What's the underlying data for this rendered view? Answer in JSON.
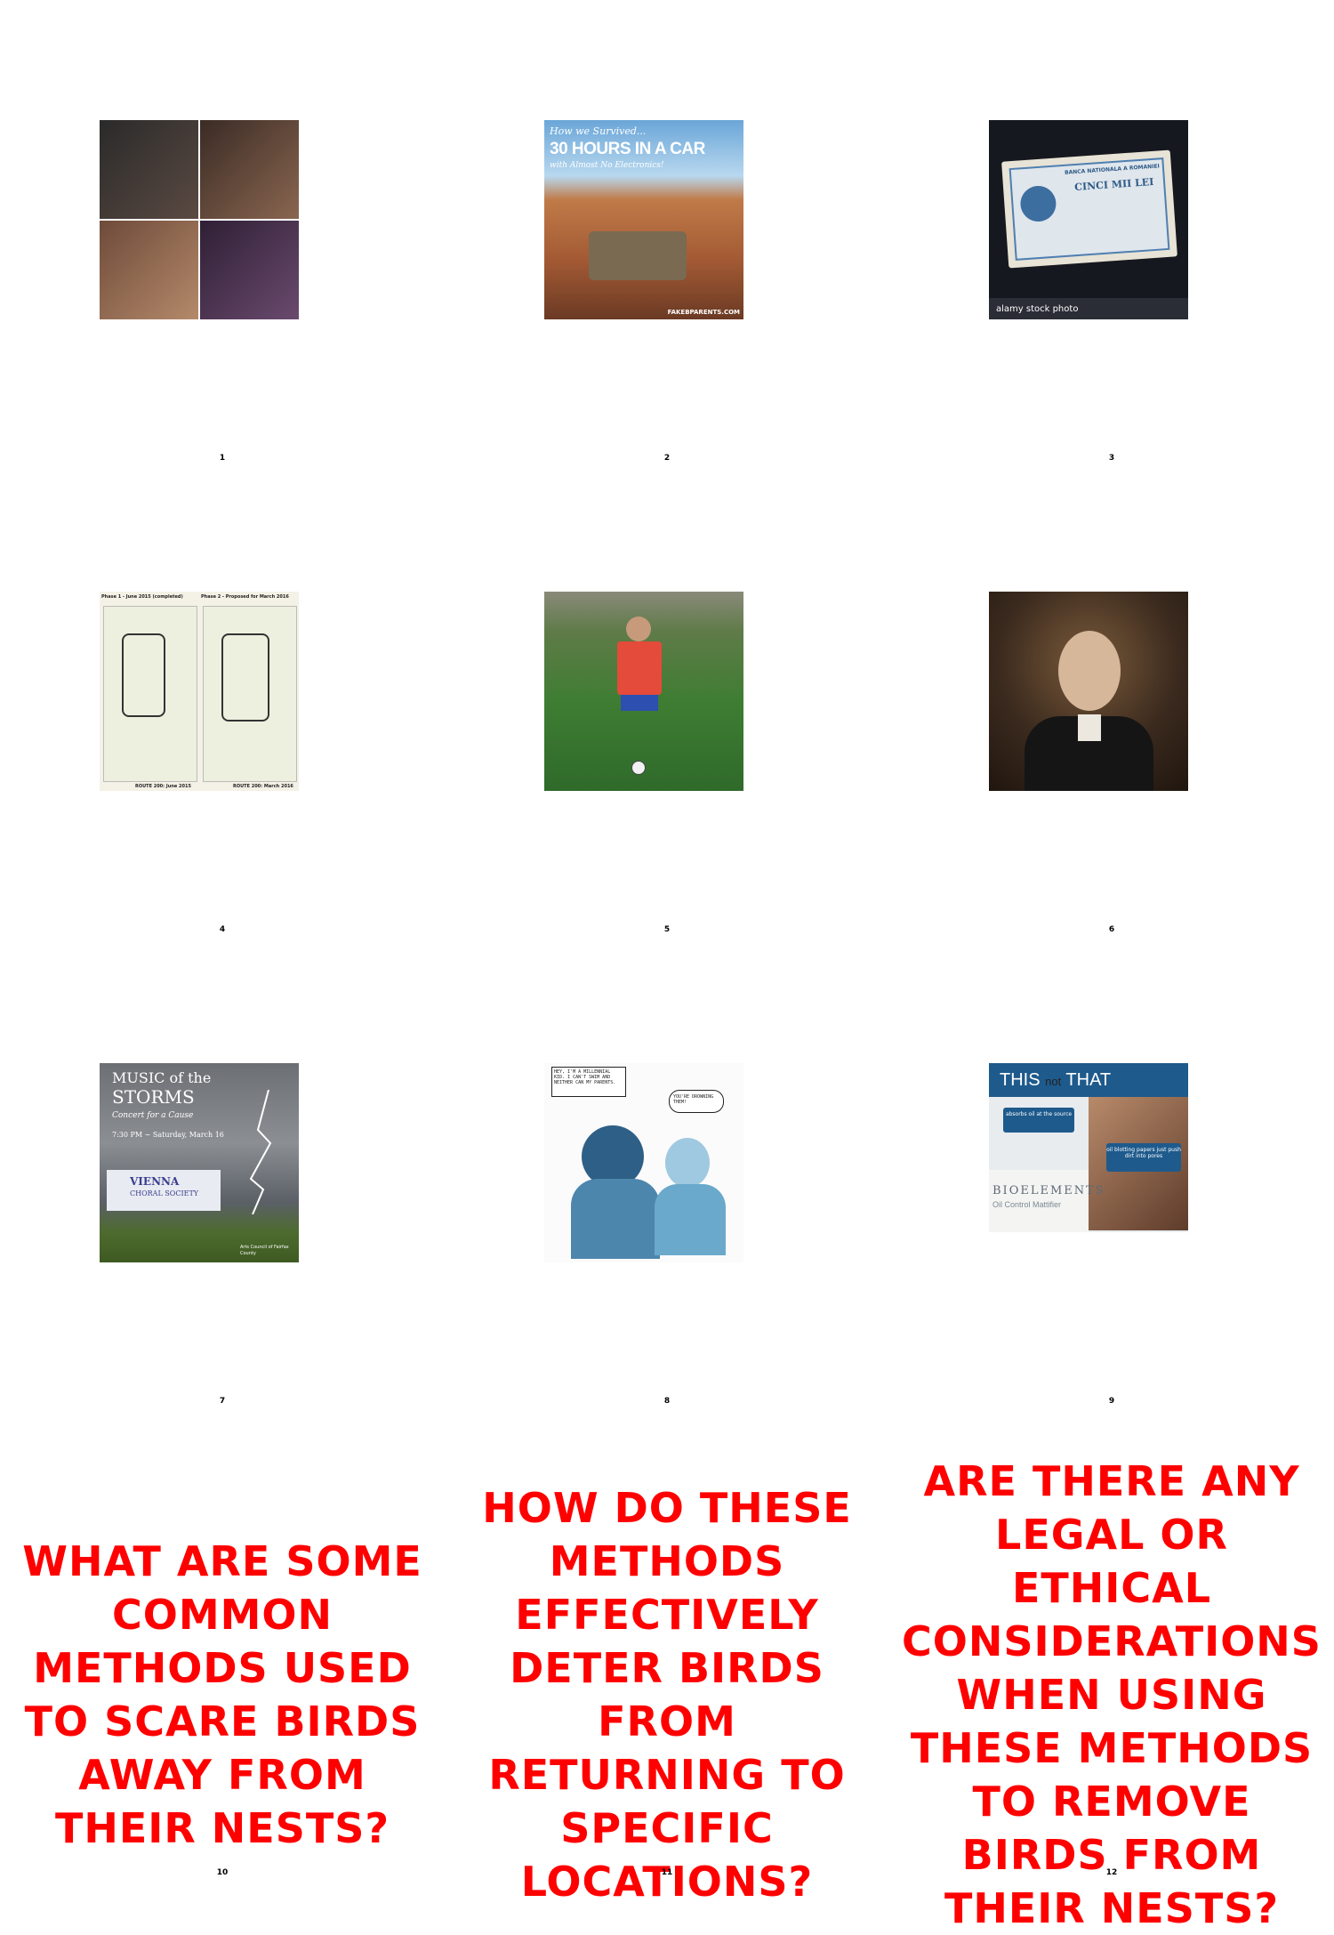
{
  "cells": [
    {
      "caption": "1",
      "image": "collage of four group selfie photos"
    },
    {
      "caption": "2",
      "image": "family station wagon in desert with text",
      "overlay": {
        "line1": "How we Survived...",
        "line2": "30 HOURS IN A CAR",
        "line3": "with Almost No Electronics!",
        "credit": "FAKEBPARENTS.COM"
      }
    },
    {
      "caption": "3",
      "image": "romanian banknote stock photo",
      "overlay": {
        "note_title": "BANCA NATIONALA A ROMANIEI",
        "note_value": "CINCI MII LEI",
        "footer": "alamy stock photo"
      }
    },
    {
      "caption": "4",
      "image": "two route maps side by side",
      "overlay": {
        "left_title": "Phase 1 - June 2015 (completed)",
        "right_title": "Phase 2 - Proposed for March 2016",
        "left_footer": "ROUTE 200: June 2015",
        "right_footer": "ROUTE 200: March 2016"
      }
    },
    {
      "caption": "5",
      "image": "soccer player in red training bib"
    },
    {
      "caption": "6",
      "image": "painted portrait of a man"
    },
    {
      "caption": "7",
      "image": "concert poster with lightning",
      "overlay": {
        "line1": "MUSIC of the",
        "line2": "STORMS",
        "line3": "Concert for a Cause",
        "line4": "7:30 PM ~ Saturday, March 16",
        "org1": "VIENNA",
        "org2": "CHORAL SOCIETY",
        "footer": "Arts Council of Fairfax County"
      }
    },
    {
      "caption": "8",
      "image": "sketch comic of two people",
      "overlay": {
        "bubble_left": "HEY, I'M A MILLENNIAL KID. I CAN'T SWIM AND NEITHER CAN MY PARENTS.",
        "bubble_right": "YOU'RE DROWNING THEM!"
      }
    },
    {
      "caption": "9",
      "image": "skincare product advertisement",
      "overlay": {
        "title_a": "THIS",
        "title_b": "not",
        "title_c": "THAT",
        "badge1": "absorbs oil at the source",
        "badge2": "oil blotting papers just push dirt into pores",
        "brand": "BIOELEMENTS",
        "product": "Oil Control Mattifier"
      }
    },
    {
      "caption": "10",
      "question": "WHAT ARE SOME COMMON METHODS USED TO SCARE BIRDS AWAY FROM THEIR NESTS?"
    },
    {
      "caption": "11",
      "question": "HOW DO THESE METHODS EFFECTIVELY DETER BIRDS FROM RETURNING TO SPECIFIC LOCATIONS?"
    },
    {
      "caption": "12",
      "question": "ARE THERE ANY LEGAL OR ETHICAL CONSIDERATIONS WHEN USING THESE METHODS TO REMOVE BIRDS FROM THEIR NESTS?"
    }
  ],
  "colors": {
    "question": "#ff0000",
    "caption": "#000000",
    "background": "#ffffff"
  }
}
